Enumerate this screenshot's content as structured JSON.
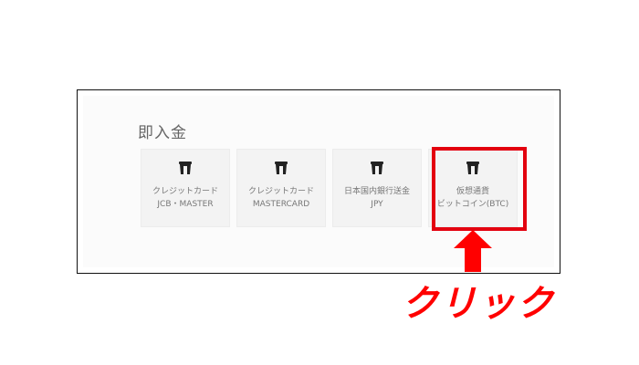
{
  "section": {
    "title": "即入金"
  },
  "cards": [
    {
      "line1": "クレジットカード",
      "line2": "JCB・MASTER",
      "icon": "wallet-icon"
    },
    {
      "line1": "クレジットカード",
      "line2": "MASTERCARD",
      "icon": "wallet-icon"
    },
    {
      "line1": "日本国内銀行送金",
      "line2": "JPY",
      "icon": "wallet-icon"
    },
    {
      "line1": "仮想通貨",
      "line2": "ビットコイン(BTC)",
      "icon": "wallet-icon"
    }
  ],
  "annotation": {
    "click_label": "クリック",
    "highlight_color": "#e3000f",
    "arrow_color": "#ff0000",
    "arrow_icon": "arrow-up-icon"
  }
}
